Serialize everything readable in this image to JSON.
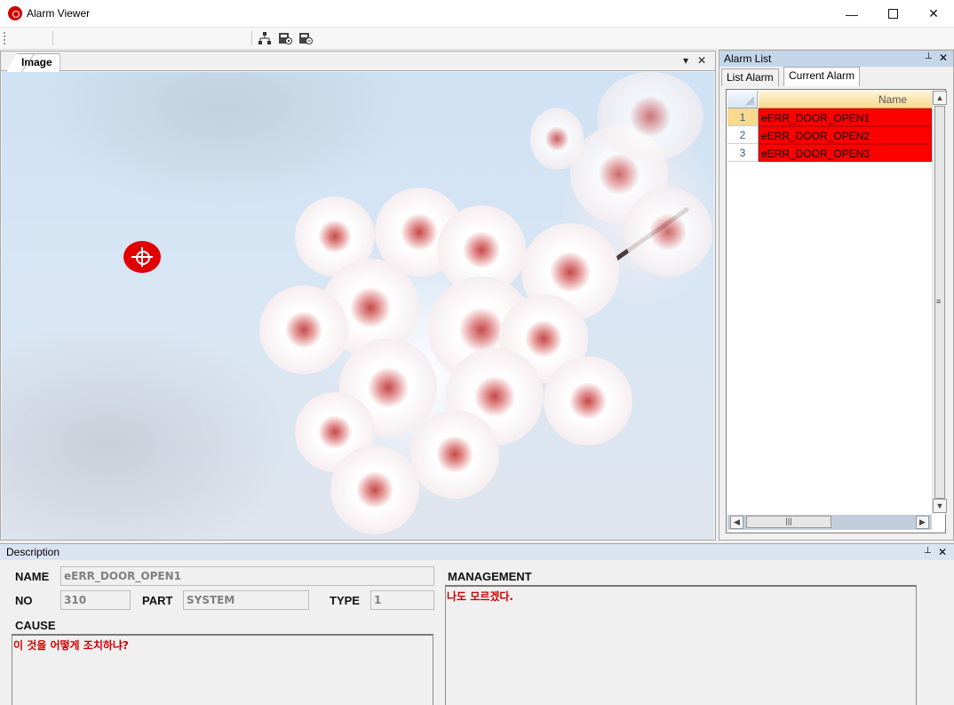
{
  "window": {
    "title": "Alarm Viewer",
    "min_glyph": "—",
    "max_glyph": "☐",
    "close_glyph": "✕"
  },
  "image_panel": {
    "tab_label": "Image",
    "dropdown_glyph": "▾",
    "close_glyph": "✕"
  },
  "alarm_panel": {
    "title": "Alarm List",
    "pin_glyph": "📌",
    "close_glyph": "✕",
    "tabs": [
      {
        "label": "List Alarm"
      },
      {
        "label": "Current Alarm"
      }
    ],
    "column_header": "Name",
    "rows": [
      {
        "no": "1",
        "name": "eERR_DOOR_OPEN1"
      },
      {
        "no": "2",
        "name": "eERR_DOOR_OPEN2"
      },
      {
        "no": "3",
        "name": "eERR_DOOR_OPEN3"
      }
    ],
    "row_color": "#ff0000",
    "selected_row_color": "#f9d98e"
  },
  "description": {
    "title": "Description",
    "name_label": "NAME",
    "name_value": "eERR_DOOR_OPEN1",
    "no_label": "NO",
    "no_value": "310",
    "part_label": "PART",
    "part_value": "SYSTEM",
    "type_label": "TYPE",
    "type_value": "1",
    "cause_label": "CAUSE",
    "cause_text": "이 것을 어떻게 조치하냐?",
    "management_label": "MANAGEMENT",
    "management_text": "나도 모르겠다."
  }
}
